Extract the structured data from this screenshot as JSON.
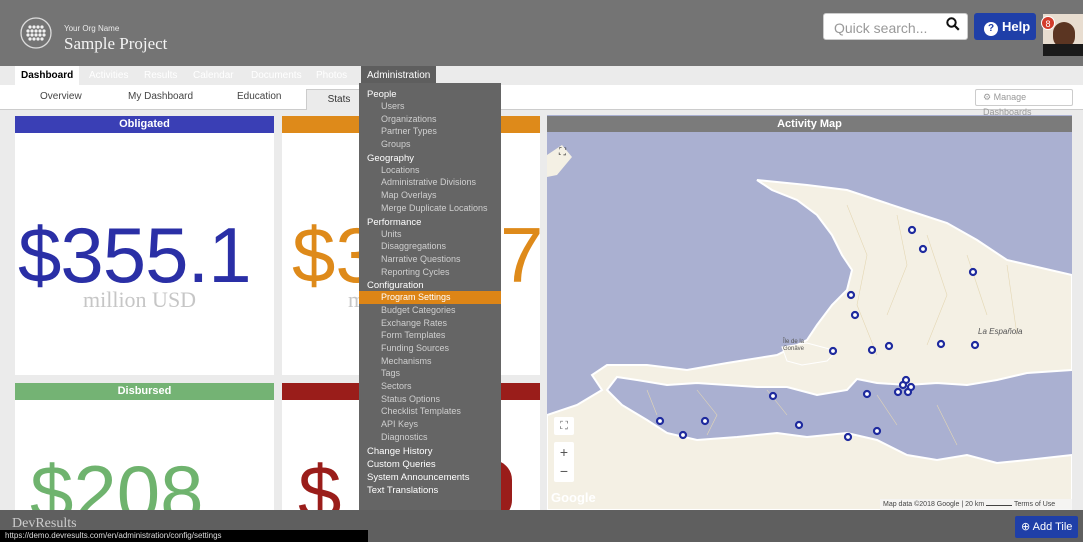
{
  "header": {
    "org_name": "Your Org Name",
    "project_name": "Sample Project",
    "search_placeholder": "Quick search...",
    "help_label": "Help",
    "notification_count": "8"
  },
  "tabs": [
    "Dashboard",
    "Activities",
    "Results",
    "Calendar",
    "Documents",
    "Photos",
    "Administration"
  ],
  "subtabs": {
    "overview": "Overview",
    "my_dashboard": "My Dashboard",
    "education": "Education",
    "stats": "Stats",
    "manage": "Manage Dashboards"
  },
  "tiles": {
    "obligated_title": "Obligated",
    "obligated_value": "$355.1",
    "obligated_unit": "million USD",
    "tile2_value": "$3",
    "tile2_value_tail": "7",
    "tile2_unit": "m",
    "disbursed_title": "Disbursed",
    "disbursed_value": "$208",
    "tile4_value": "$"
  },
  "map": {
    "title": "Activity Map",
    "label_espanola": "La Española",
    "label_ile": "Île de la Gonâve",
    "zoom_in": "+",
    "zoom_out": "−",
    "google": "Google",
    "attribution": "Map data ©2018 Google",
    "scale": "20 km",
    "terms": "Terms of Use"
  },
  "menu": {
    "people": "People",
    "users": "Users",
    "organizations": "Organizations",
    "partner_types": "Partner Types",
    "groups": "Groups",
    "geography": "Geography",
    "locations": "Locations",
    "admin_divisions": "Administrative Divisions",
    "map_overlays": "Map Overlays",
    "merge_locations": "Merge Duplicate Locations",
    "performance": "Performance",
    "units": "Units",
    "disaggregations": "Disaggregations",
    "narrative_questions": "Narrative Questions",
    "reporting_cycles": "Reporting Cycles",
    "configuration": "Configuration",
    "program_settings": "Program Settings",
    "budget_categories": "Budget Categories",
    "exchange_rates": "Exchange Rates",
    "form_templates": "Form Templates",
    "funding_sources": "Funding Sources",
    "mechanisms": "Mechanisms",
    "tags": "Tags",
    "sectors": "Sectors",
    "status_options": "Status Options",
    "checklist_templates": "Checklist Templates",
    "api_keys": "API Keys",
    "diagnostics": "Diagnostics",
    "change_history": "Change History",
    "custom_queries": "Custom Queries",
    "system_announcements": "System Announcements",
    "text_translations": "Text Translations"
  },
  "footer": {
    "logo": "DevResults",
    "add_tile": "Add Tile",
    "status_url": "https://demo.devresults.com/en/administration/config/settings"
  },
  "colors": {
    "obligated": "#3a3fb5",
    "tile2": "#de8a1a",
    "disbursed": "#74b374",
    "tile4": "#9a1d1a",
    "accent": "#1f3fa8",
    "menu_highlight": "#dd8516"
  }
}
